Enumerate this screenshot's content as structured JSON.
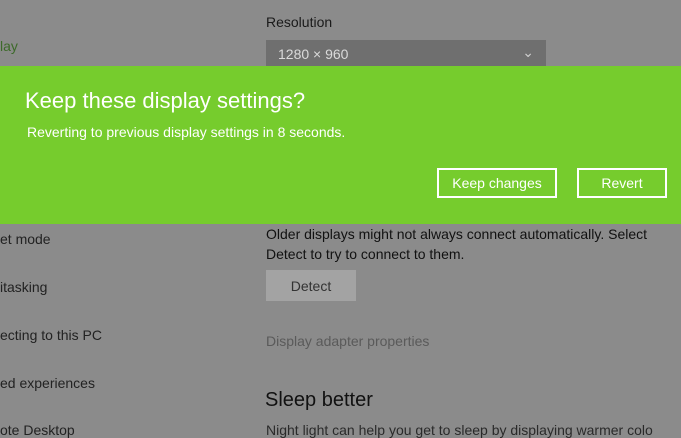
{
  "sidebar": {
    "items": [
      {
        "label": "lay",
        "active": true
      },
      {
        "label": "et mode"
      },
      {
        "label": "itasking"
      },
      {
        "label": "ecting to this PC"
      },
      {
        "label": "ed experiences"
      },
      {
        "label": "ote Desktop"
      }
    ]
  },
  "display": {
    "resolution_label": "Resolution",
    "resolution_value": "1280 × 960",
    "detect_description": "Older displays might not always connect automatically. Select Detect to try to connect to them.",
    "detect_button": "Detect",
    "adapter_link": "Display adapter properties",
    "sleep_title": "Sleep better",
    "sleep_desc": "Night light can help you get to sleep by displaying warmer colo"
  },
  "dialog": {
    "title": "Keep these display settings?",
    "message": "Reverting to previous display settings in  8 seconds.",
    "keep_button": "Keep changes",
    "revert_button": "Revert"
  },
  "colors": {
    "banner": "#76cc2d",
    "overlay": "#8b8b8b"
  }
}
